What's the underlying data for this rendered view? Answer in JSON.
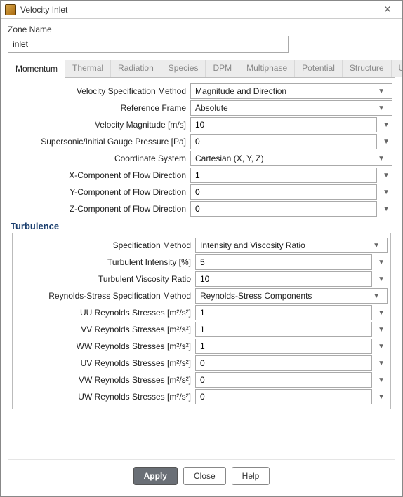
{
  "window": {
    "title": "Velocity Inlet"
  },
  "zone": {
    "label": "Zone Name",
    "value": "inlet"
  },
  "tabs": [
    "Momentum",
    "Thermal",
    "Radiation",
    "Species",
    "DPM",
    "Multiphase",
    "Potential",
    "Structure",
    "UDS"
  ],
  "active_tab": "Momentum",
  "momentum": {
    "velocity_spec_method": {
      "label": "Velocity Specification Method",
      "value": "Magnitude and Direction"
    },
    "reference_frame": {
      "label": "Reference Frame",
      "value": "Absolute"
    },
    "velocity_magnitude": {
      "label": "Velocity Magnitude [m/s]",
      "value": "10"
    },
    "supersonic_pressure": {
      "label": "Supersonic/Initial Gauge Pressure [Pa]",
      "value": "0"
    },
    "coordinate_system": {
      "label": "Coordinate System",
      "value": "Cartesian (X, Y, Z)"
    },
    "x_component": {
      "label": "X-Component of Flow Direction",
      "value": "1"
    },
    "y_component": {
      "label": "Y-Component of Flow Direction",
      "value": "0"
    },
    "z_component": {
      "label": "Z-Component of Flow Direction",
      "value": "0"
    }
  },
  "turbulence": {
    "title": "Turbulence",
    "spec_method": {
      "label": "Specification Method",
      "value": "Intensity and Viscosity Ratio"
    },
    "turb_intensity": {
      "label": "Turbulent Intensity [%]",
      "value": "5"
    },
    "turb_visc_ratio": {
      "label": "Turbulent Viscosity Ratio",
      "value": "10"
    },
    "reynolds_spec_method": {
      "label": "Reynolds-Stress Specification Method",
      "value": "Reynolds-Stress Components"
    },
    "uu": {
      "label": "UU Reynolds Stresses [m²/s²]",
      "value": "1"
    },
    "vv": {
      "label": "VV Reynolds Stresses [m²/s²]",
      "value": "1"
    },
    "ww": {
      "label": "WW Reynolds Stresses [m²/s²]",
      "value": "1"
    },
    "uv": {
      "label": "UV Reynolds Stresses [m²/s²]",
      "value": "0"
    },
    "vw": {
      "label": "VW Reynolds Stresses [m²/s²]",
      "value": "0"
    },
    "uw": {
      "label": "UW Reynolds Stresses [m²/s²]",
      "value": "0"
    }
  },
  "footer": {
    "apply": "Apply",
    "close": "Close",
    "help": "Help"
  }
}
